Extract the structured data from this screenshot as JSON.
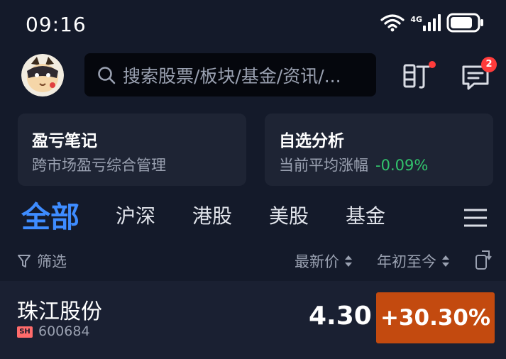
{
  "status_bar": {
    "time": "09:16",
    "network": "4G",
    "icons": [
      "wifi-icon",
      "cellular-signal-icon",
      "battery-icon"
    ]
  },
  "header": {
    "search_placeholder": "搜索股票/板块/基金/资讯/...",
    "watch_icon": "watch-icon",
    "message_icon": "message-icon",
    "message_badge": "2"
  },
  "cards": {
    "profit_notes": {
      "title": "盈亏笔记",
      "subtitle": "跨市场盈亏综合管理"
    },
    "watchlist_analysis": {
      "title": "自选分析",
      "subtitle": "当前平均涨幅",
      "value": "-0.09%"
    }
  },
  "tabs": [
    {
      "label": "全部",
      "active": true
    },
    {
      "label": "沪深",
      "active": false
    },
    {
      "label": "港股",
      "active": false
    },
    {
      "label": "美股",
      "active": false
    },
    {
      "label": "基金",
      "active": false
    }
  ],
  "list_header": {
    "filter_label": "筛选",
    "price_label": "最新价",
    "change_label": "年初至今"
  },
  "stocks": [
    {
      "name": "珠江股份",
      "market": "SH",
      "code": "600684",
      "price": "4.30",
      "change": "+30.30%"
    }
  ],
  "colors": {
    "background": "#141a2a",
    "accent": "#3e8cff",
    "positive_change_bg": "#c34a0f",
    "negative_text": "#32c36c"
  }
}
